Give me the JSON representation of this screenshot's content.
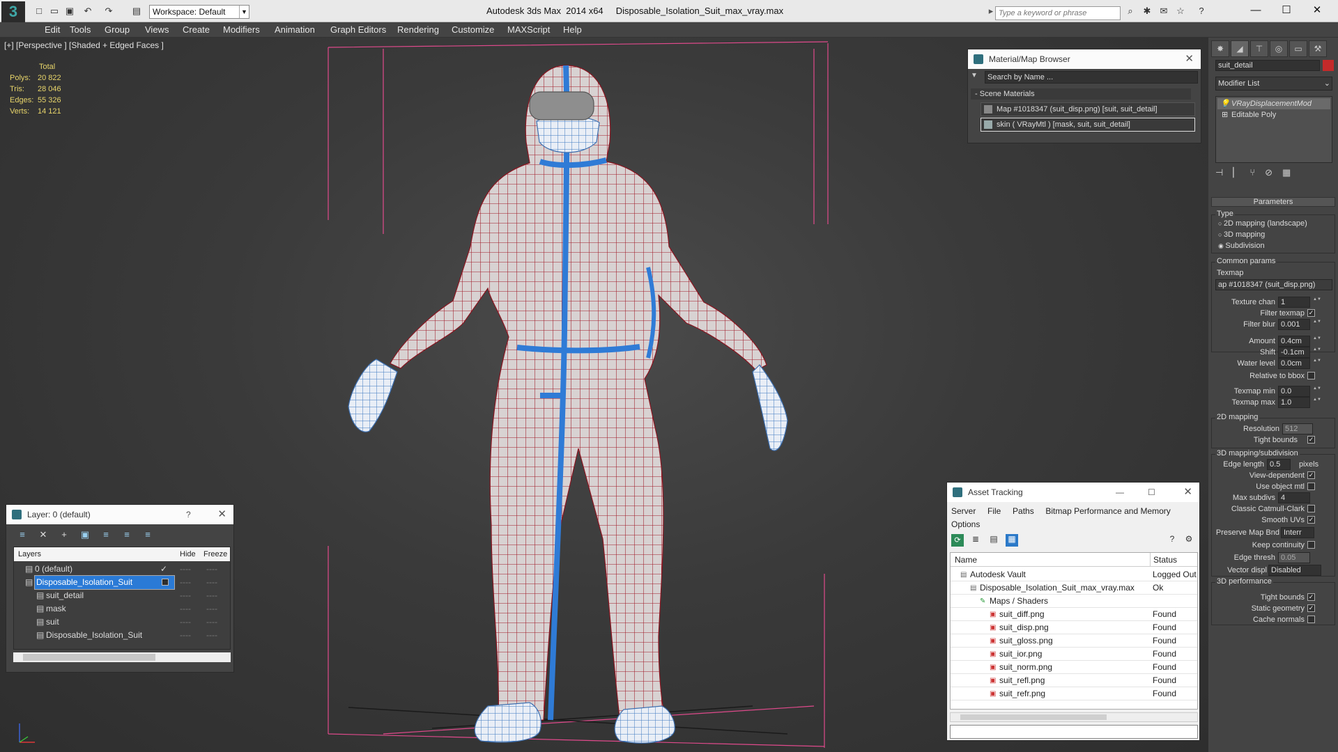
{
  "titlebar": {
    "app": "Autodesk 3ds Max  2014 x64",
    "file": "Disposable_Isolation_Suit_max_vray.max",
    "workspace": "Workspace: Default",
    "search_placeholder": "Type a keyword or phrase"
  },
  "menus": [
    "Edit",
    "Tools",
    "Group",
    "Views",
    "Create",
    "Modifiers",
    "Animation",
    "Graph Editors",
    "Rendering",
    "Customize",
    "MAXScript",
    "Help"
  ],
  "viewport": {
    "label": "[+] [Perspective ] [Shaded + Edged Faces ]",
    "stats_header": "Total",
    "stats": [
      {
        "k": "Polys:",
        "v": "20 822"
      },
      {
        "k": "Tris:",
        "v": "28 046"
      },
      {
        "k": "Edges:",
        "v": "55 326"
      },
      {
        "k": "Verts:",
        "v": "14 121"
      }
    ]
  },
  "material_browser": {
    "title": "Material/Map Browser",
    "search": "Search by Name ...",
    "section": "Scene Materials",
    "items": [
      "Map #1018347 (suit_disp.png) [suit, suit_detail]",
      "skin  ( VRayMtl )  [mask, suit, suit_detail]"
    ]
  },
  "layers": {
    "title": "Layer: 0 (default)",
    "help": "?",
    "cols": [
      "Layers",
      "Hide",
      "Freeze"
    ],
    "rows": [
      {
        "name": "0 (default)",
        "indent": 0
      },
      {
        "name": "Disposable_Isolation_Suit",
        "indent": 0,
        "selected": true
      },
      {
        "name": "suit_detail",
        "indent": 1
      },
      {
        "name": "mask",
        "indent": 1
      },
      {
        "name": "suit",
        "indent": 1
      },
      {
        "name": "Disposable_Isolation_Suit",
        "indent": 1
      }
    ]
  },
  "asset_tracking": {
    "title": "Asset Tracking",
    "menus": [
      "Server",
      "File",
      "Paths",
      "Bitmap Performance and Memory",
      "Options"
    ],
    "cols": [
      "Name",
      "Status"
    ],
    "rows": [
      {
        "name": "Autodesk Vault",
        "status": "Logged Out",
        "indent": 1
      },
      {
        "name": "Disposable_Isolation_Suit_max_vray.max",
        "status": "Ok",
        "indent": 2
      },
      {
        "name": "Maps / Shaders",
        "status": "",
        "indent": 3
      },
      {
        "name": "suit_diff.png",
        "status": "Found",
        "indent": 4
      },
      {
        "name": "suit_disp.png",
        "status": "Found",
        "indent": 4
      },
      {
        "name": "suit_gloss.png",
        "status": "Found",
        "indent": 4
      },
      {
        "name": "suit_ior.png",
        "status": "Found",
        "indent": 4
      },
      {
        "name": "suit_norm.png",
        "status": "Found",
        "indent": 4
      },
      {
        "name": "suit_refl.png",
        "status": "Found",
        "indent": 4
      },
      {
        "name": "suit_refr.png",
        "status": "Found",
        "indent": 4
      }
    ]
  },
  "command_panel": {
    "object_name": "suit_detail",
    "modifier_list": "Modifier List",
    "stack": [
      "VRayDisplacementMod",
      "Editable Poly"
    ],
    "rollout": "Parameters",
    "type_label": "Type",
    "type_options": [
      "2D mapping (landscape)",
      "3D mapping",
      "Subdivision"
    ],
    "common_params": "Common params",
    "texmap": "Texmap",
    "texmap_value": "ap #1018347 (suit_disp.png)",
    "fields": [
      {
        "label": "Texture chan",
        "value": "1"
      },
      {
        "label": "Filter texmap",
        "check": true
      },
      {
        "label": "Filter blur",
        "value": "0.001"
      },
      {
        "label": "Amount",
        "value": "0.4cm"
      },
      {
        "label": "Shift",
        "value": "-0.1cm"
      },
      {
        "label": "Water level",
        "value": "0.0cm"
      },
      {
        "label": "Relative to bbox",
        "check": false
      },
      {
        "label": "Texmap min",
        "value": "0.0"
      },
      {
        "label": "Texmap max",
        "value": "1.0"
      }
    ],
    "g2d": "2D mapping",
    "resolution_label": "Resolution",
    "resolution": "512",
    "tight_bounds": "Tight bounds",
    "g3d": "3D mapping/subdivision",
    "edge_length_label": "Edge length",
    "edge_length": "0.5",
    "pixels": "pixels",
    "view_dependent": "View-dependent",
    "use_object_mtl": "Use object mtl",
    "max_subdivs_label": "Max subdivs",
    "max_subdivs": "4",
    "catmull": "Classic Catmull-Clark",
    "smooth_uvs": "Smooth UVs",
    "preserve_label": "Preserve Map Bnd",
    "preserve_value": "Interr",
    "keep_continuity": "Keep continuity",
    "edge_thresh_label": "Edge thresh",
    "edge_thresh": "0.05",
    "vector_label": "Vector displ",
    "vector_value": "Disabled",
    "gperf": "3D performance",
    "tight_bounds2": "Tight bounds",
    "static_geometry": "Static geometry",
    "cache_normals": "Cache normals"
  }
}
